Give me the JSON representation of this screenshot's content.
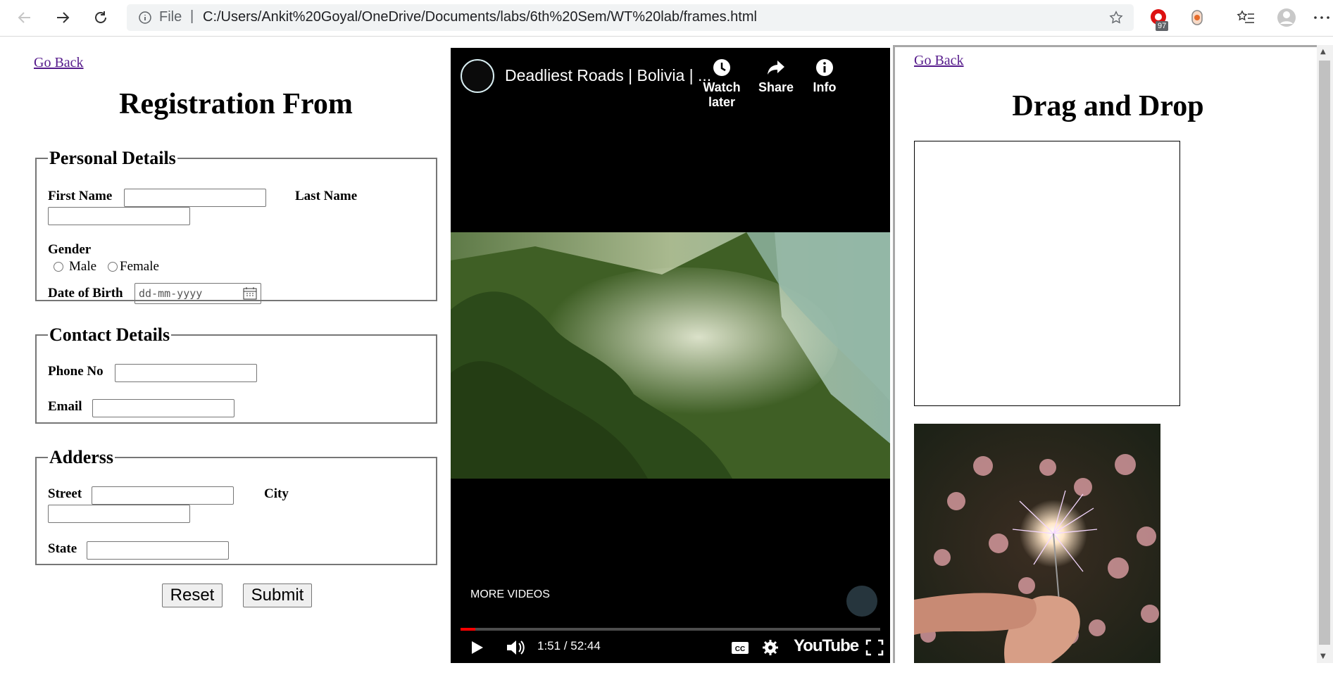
{
  "browser": {
    "file_label": "File",
    "separator": "|",
    "url": "C:/Users/Ankit%20Goyal/OneDrive/Documents/labs/6th%20Sem/WT%20lab/frames.html",
    "extension_badge": "97"
  },
  "form_frame": {
    "back_link": "Go Back",
    "title": "Registration From",
    "personal": {
      "legend": "Personal Details",
      "first_name": "First Name",
      "last_name": "Last Name",
      "gender": "Gender",
      "male": "Male",
      "female": "Female",
      "dob": "Date of Birth",
      "dob_placeholder": "dd-mm-yyyy"
    },
    "contact": {
      "legend": "Contact Details",
      "phone": "Phone No",
      "email": "Email"
    },
    "address": {
      "legend": "Adderss",
      "street": "Street",
      "city": "City",
      "state": "State"
    },
    "reset": "Reset",
    "submit": "Submit"
  },
  "video_frame": {
    "title": "Deadliest Roads | Bolivia | ...",
    "watch_later": "Watch later",
    "share": "Share",
    "info": "Info",
    "more_videos": "MORE VIDEOS",
    "time": "1:51 / 52:44",
    "brand": "YouTube",
    "progress": 0.035
  },
  "dnd_frame": {
    "back_link": "Go Back",
    "title": "Drag and Drop"
  },
  "colors": {
    "link": "#551a8b",
    "progress": "#ff0000",
    "video_bg": "#000000"
  }
}
